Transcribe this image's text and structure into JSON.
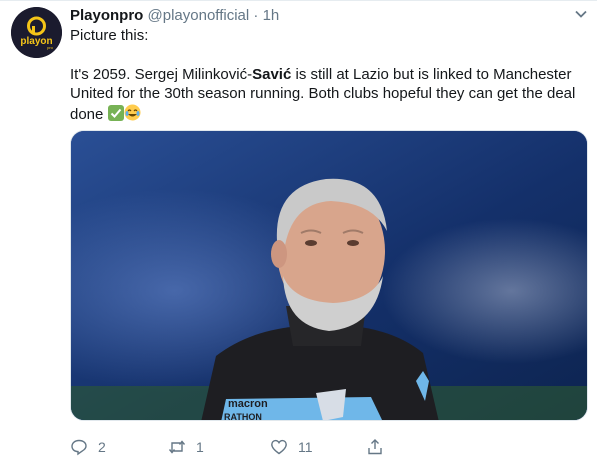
{
  "tweet": {
    "name": "Playonpro",
    "handle": "@playonofficial",
    "separator": "·",
    "time": "1h",
    "avatar_text": "playon",
    "avatar_sub": "pro",
    "line1": "Picture this:",
    "p2_before": "It's 2059. Sergej Milinković-",
    "p2_bold": "Savić",
    "p2_after": " is still at Lazio but is linked to Manchester United for the 30th season running. Both clubs hopeful they can get the deal done",
    "image_texts": {
      "brand": "macron",
      "sub": "RATHON"
    }
  },
  "actions": {
    "replies": "2",
    "retweets": "1",
    "likes": "11"
  },
  "icons": [
    "playon-logo-icon",
    "chevron-down-icon",
    "check-mark-emoji",
    "laughing-emoji",
    "reply-icon",
    "retweet-icon",
    "like-icon",
    "share-icon"
  ],
  "colors": {
    "brand_yellow": "#f5c518",
    "muted": "#657786",
    "check_green": "#77b255"
  }
}
